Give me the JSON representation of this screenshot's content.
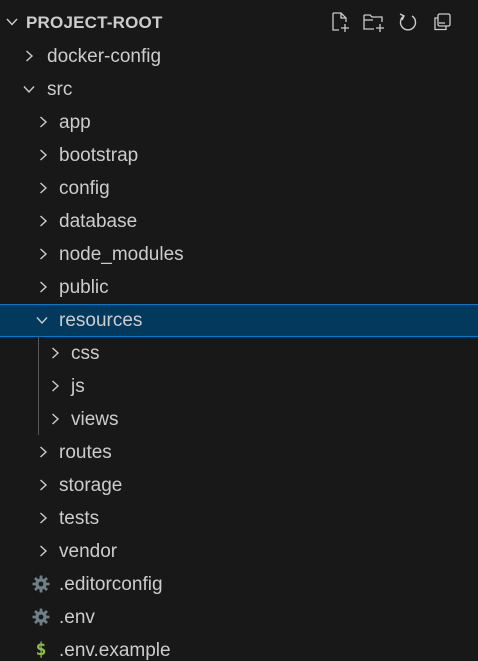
{
  "explorer": {
    "title": "PROJECT-ROOT",
    "actions": [
      {
        "name": "new-file-icon"
      },
      {
        "name": "new-folder-icon"
      },
      {
        "name": "refresh-icon"
      },
      {
        "name": "collapse-all-icon"
      }
    ],
    "items": [
      {
        "label": "docker-config",
        "type": "folder",
        "expanded": false,
        "depth": 1
      },
      {
        "label": "src",
        "type": "folder",
        "expanded": true,
        "depth": 1
      },
      {
        "label": "app",
        "type": "folder",
        "expanded": false,
        "depth": 2
      },
      {
        "label": "bootstrap",
        "type": "folder",
        "expanded": false,
        "depth": 2
      },
      {
        "label": "config",
        "type": "folder",
        "expanded": false,
        "depth": 2
      },
      {
        "label": "database",
        "type": "folder",
        "expanded": false,
        "depth": 2
      },
      {
        "label": "node_modules",
        "type": "folder",
        "expanded": false,
        "depth": 2
      },
      {
        "label": "public",
        "type": "folder",
        "expanded": false,
        "depth": 2
      },
      {
        "label": "resources",
        "type": "folder",
        "expanded": true,
        "depth": 2,
        "selected": true
      },
      {
        "label": "css",
        "type": "folder",
        "expanded": false,
        "depth": 3
      },
      {
        "label": "js",
        "type": "folder",
        "expanded": false,
        "depth": 3
      },
      {
        "label": "views",
        "type": "folder",
        "expanded": false,
        "depth": 3
      },
      {
        "label": "routes",
        "type": "folder",
        "expanded": false,
        "depth": 2
      },
      {
        "label": "storage",
        "type": "folder",
        "expanded": false,
        "depth": 2
      },
      {
        "label": "tests",
        "type": "folder",
        "expanded": false,
        "depth": 2
      },
      {
        "label": "vendor",
        "type": "folder",
        "expanded": false,
        "depth": 2
      },
      {
        "label": ".editorconfig",
        "type": "file",
        "icon": "gear-icon",
        "depth": 2
      },
      {
        "label": ".env",
        "type": "file",
        "icon": "gear-icon",
        "depth": 2
      },
      {
        "label": ".env.example",
        "type": "file",
        "icon": "dollar-icon",
        "icon_text": "$",
        "depth": 2
      }
    ]
  },
  "colors": {
    "background": "#181818",
    "text": "#cccccc",
    "selection_bg": "#04395e",
    "selection_border": "#0078d4",
    "gear_icon": "#6d8086",
    "dollar_icon": "#8dc149"
  }
}
